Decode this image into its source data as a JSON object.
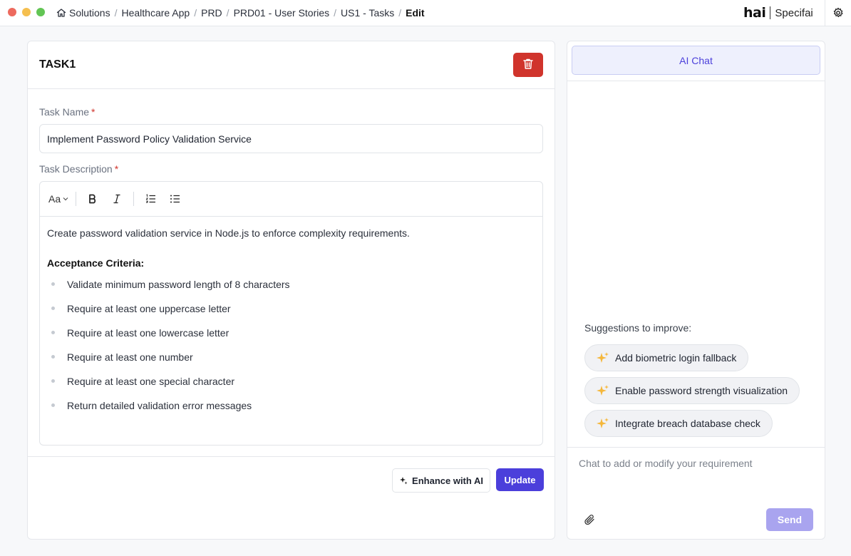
{
  "window": {
    "colors": {
      "close": "#ed6a5e",
      "minimize": "#f5bf4f",
      "maximize": "#62c554"
    }
  },
  "breadcrumb": {
    "home_icon": "home-icon",
    "items": [
      "Solutions",
      "Healthcare App",
      "PRD",
      "PRD01 - User Stories",
      "US1 - Tasks"
    ],
    "current": "Edit"
  },
  "header": {
    "logo_primary": "hai",
    "logo_secondary": "Specifai",
    "settings_icon": "gear-icon"
  },
  "task": {
    "title": "TASK1",
    "delete_icon": "trash-icon",
    "name_label": "Task Name",
    "name_value": "Implement Password Policy Validation Service",
    "description_label": "Task Description",
    "required_mark": "*",
    "toolbar": {
      "font_size_label": "Aa",
      "icons": [
        "bold-icon",
        "italic-icon",
        "ordered-list-icon",
        "bullet-list-icon"
      ]
    },
    "description": {
      "intro": "Create password validation service in Node.js to enforce complexity requirements.",
      "criteria_heading": "Acceptance Criteria:",
      "criteria": [
        "Validate minimum password length of 8 characters",
        "Require at least one uppercase letter",
        "Require at least one lowercase letter",
        "Require at least one number",
        "Require at least one special character",
        "Return detailed validation error messages"
      ]
    },
    "enhance_label": "Enhance with AI",
    "update_label": "Update"
  },
  "chat": {
    "tab_label": "AI Chat",
    "suggestions_title": "Suggestions to improve:",
    "suggestions": [
      "Add biometric login fallback",
      "Enable password strength visualization",
      "Integrate breach database check"
    ],
    "input_placeholder": "Chat to add or modify your requirement",
    "attach_icon": "paperclip-icon",
    "send_label": "Send"
  },
  "colors": {
    "accent": "#4b3fdb",
    "danger": "#d0342c",
    "send_disabled": "#a9a4ef",
    "sparkle": "#f5b73b"
  }
}
